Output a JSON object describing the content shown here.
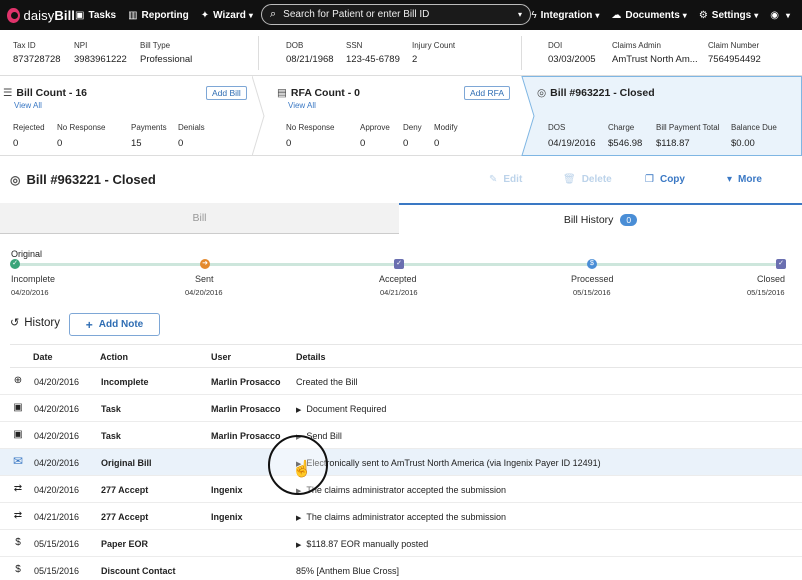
{
  "app": {
    "logo": "daisyBill"
  },
  "nav": {
    "tasks": "Tasks",
    "reporting": "Reporting",
    "wizard": "Wizard",
    "search_placeholder": "Search for Patient or enter Bill ID",
    "integration": "Integration",
    "documents": "Documents",
    "settings": "Settings"
  },
  "info": {
    "tax_id": {
      "label": "Tax ID",
      "value": "873728728"
    },
    "npi": {
      "label": "NPI",
      "value": "3983961222"
    },
    "bill_type": {
      "label": "Bill Type",
      "value": "Professional"
    },
    "dob": {
      "label": "DOB",
      "value": "08/21/1968"
    },
    "ssn": {
      "label": "SSN",
      "value": "123-45-6789"
    },
    "injury_count": {
      "label": "Injury Count",
      "value": "2"
    },
    "doi": {
      "label": "DOI",
      "value": "03/03/2005"
    },
    "claims_admin": {
      "label": "Claims Admin",
      "value": "AmTrust North Am..."
    },
    "claim_number": {
      "label": "Claim Number",
      "value": "7564954492"
    }
  },
  "cards": {
    "bills": {
      "title": "Bill Count - 16",
      "view_all": "View All",
      "button": "Add Bill",
      "stats": [
        {
          "label": "Rejected",
          "value": "0"
        },
        {
          "label": "No Response",
          "value": "0"
        },
        {
          "label": "Payments",
          "value": "15"
        },
        {
          "label": "Denials",
          "value": "0"
        }
      ]
    },
    "rfa": {
      "title": "RFA Count - 0",
      "view_all": "View All",
      "button": "Add RFA",
      "stats": [
        {
          "label": "No Response",
          "value": "0"
        },
        {
          "label": "Approve",
          "value": "0"
        },
        {
          "label": "Deny",
          "value": "0"
        },
        {
          "label": "Modify",
          "value": "0"
        }
      ]
    },
    "bill": {
      "title": "Bill #963221 - Closed",
      "stats": [
        {
          "label": "DOS",
          "value": "04/19/2016"
        },
        {
          "label": "Charge",
          "value": "$546.98"
        },
        {
          "label": "Bill Payment Total",
          "value": "$118.87"
        },
        {
          "label": "Balance Due",
          "value": "$0.00"
        }
      ]
    }
  },
  "bill_header": {
    "title": "Bill #963221 - Closed",
    "edit": "Edit",
    "delete": "Delete",
    "copy": "Copy",
    "more": "More"
  },
  "tabs": {
    "bill": "Bill",
    "history": "Bill History",
    "history_badge": "0"
  },
  "timeline": {
    "origin_label": "Original",
    "steps": [
      {
        "label": "Incomplete",
        "date": "04/20/2016",
        "color": "#3aa57a"
      },
      {
        "label": "Sent",
        "date": "04/20/2016",
        "color": "#e48a2e"
      },
      {
        "label": "Accepted",
        "date": "04/21/2016",
        "color": "#6a6fb0"
      },
      {
        "label": "Processed",
        "date": "05/15/2016",
        "color": "#4a8ed6"
      },
      {
        "label": "Closed",
        "date": "05/15/2016",
        "color": "#6a6fb0"
      }
    ]
  },
  "history": {
    "title": "History",
    "add_note": "Add Note",
    "columns": {
      "date": "Date",
      "action": "Action",
      "user": "User",
      "details": "Details"
    },
    "rows": [
      {
        "icon": "plus-circle-icon",
        "date": "04/20/2016",
        "action": "Incomplete",
        "user": "Marlin Prosacco",
        "details": "Created the Bill",
        "expand": false
      },
      {
        "icon": "clipboard-check-icon",
        "date": "04/20/2016",
        "action": "Task",
        "user": "Marlin Prosacco",
        "details": "Document Required",
        "expand": true
      },
      {
        "icon": "clipboard-check-icon",
        "date": "04/20/2016",
        "action": "Task",
        "user": "Marlin Prosacco",
        "details": "Send Bill",
        "expand": true
      },
      {
        "icon": "envelope-icon",
        "date": "04/20/2016",
        "action": "Original Bill",
        "user": "",
        "details": "Electronically sent to AmTrust North America (via Ingenix Payer ID 12491)",
        "expand": true
      },
      {
        "icon": "exchange-icon",
        "date": "04/20/2016",
        "action": "277 Accept",
        "user": "Ingenix",
        "details": "The claims administrator accepted the submission",
        "expand": true
      },
      {
        "icon": "exchange-icon",
        "date": "04/21/2016",
        "action": "277 Accept",
        "user": "Ingenix",
        "details": "The claims administrator accepted the submission",
        "expand": true
      },
      {
        "icon": "dollar-icon",
        "date": "05/15/2016",
        "action": "Paper EOR",
        "user": "",
        "details": "$118.87 EOR manually posted",
        "expand": true
      },
      {
        "icon": "dollar-icon",
        "date": "05/15/2016",
        "action": "Discount Contact",
        "user": "",
        "details": "85% [Anthem Blue Cross]",
        "expand": false
      }
    ]
  }
}
